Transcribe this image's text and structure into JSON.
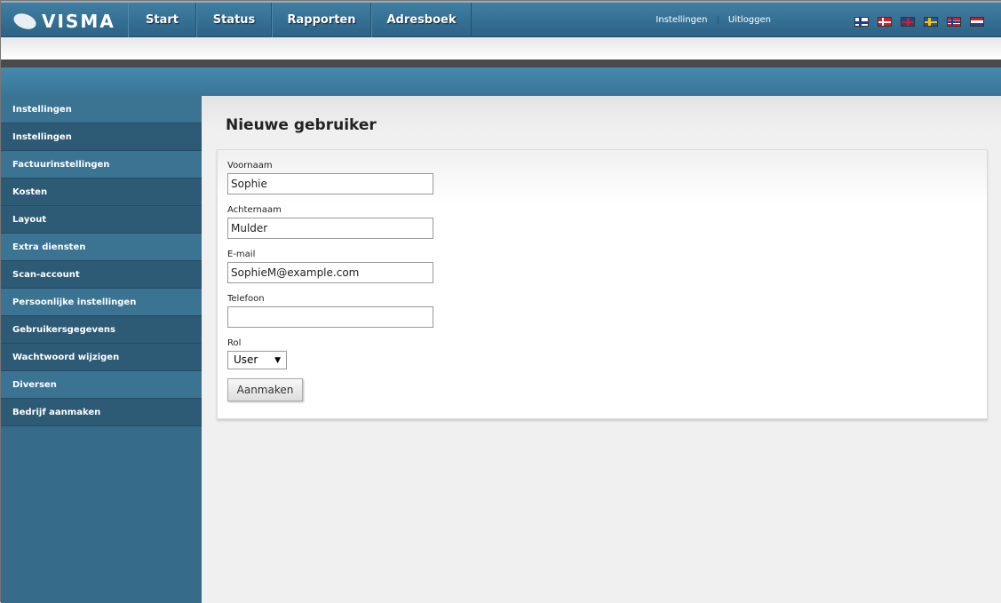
{
  "header": {
    "logo": "VISMA",
    "nav": [
      "Start",
      "Status",
      "Rapporten",
      "Adresboek"
    ],
    "links": [
      "Instellingen",
      "Uitloggen"
    ],
    "flags": [
      {
        "name": "finnish-flag"
      },
      {
        "name": "danish-flag"
      },
      {
        "name": "uk-flag"
      },
      {
        "name": "swedish-flag"
      },
      {
        "name": "norwegian-flag"
      },
      {
        "name": "dutch-flag"
      }
    ]
  },
  "sidebar": {
    "items": [
      {
        "label": "Instellingen",
        "style": "l"
      },
      {
        "label": "Instellingen",
        "style": "d"
      },
      {
        "label": "Factuurinstellingen",
        "style": "l"
      },
      {
        "label": "Kosten",
        "style": "d"
      },
      {
        "label": "Layout",
        "style": "d"
      },
      {
        "label": "Extra diensten",
        "style": "l"
      },
      {
        "label": "Scan-account",
        "style": "d"
      },
      {
        "label": "Persoonlijke instellingen",
        "style": "l"
      },
      {
        "label": "Gebruikersgegevens",
        "style": "d"
      },
      {
        "label": "Wachtwoord wijzigen",
        "style": "d"
      },
      {
        "label": "Diversen",
        "style": "l"
      },
      {
        "label": "Bedrijf aanmaken",
        "style": "d"
      }
    ]
  },
  "form": {
    "title": "Nieuwe gebruiker",
    "fields": [
      {
        "label": "Voornaam",
        "value": "Sophie"
      },
      {
        "label": "Achternaam",
        "value": "Mulder"
      },
      {
        "label": "E-mail",
        "value": "SophieM@example.com"
      },
      {
        "label": "Telefoon",
        "value": ""
      }
    ],
    "role_label": "Rol",
    "role_value": "User",
    "submit": "Aanmaken"
  }
}
